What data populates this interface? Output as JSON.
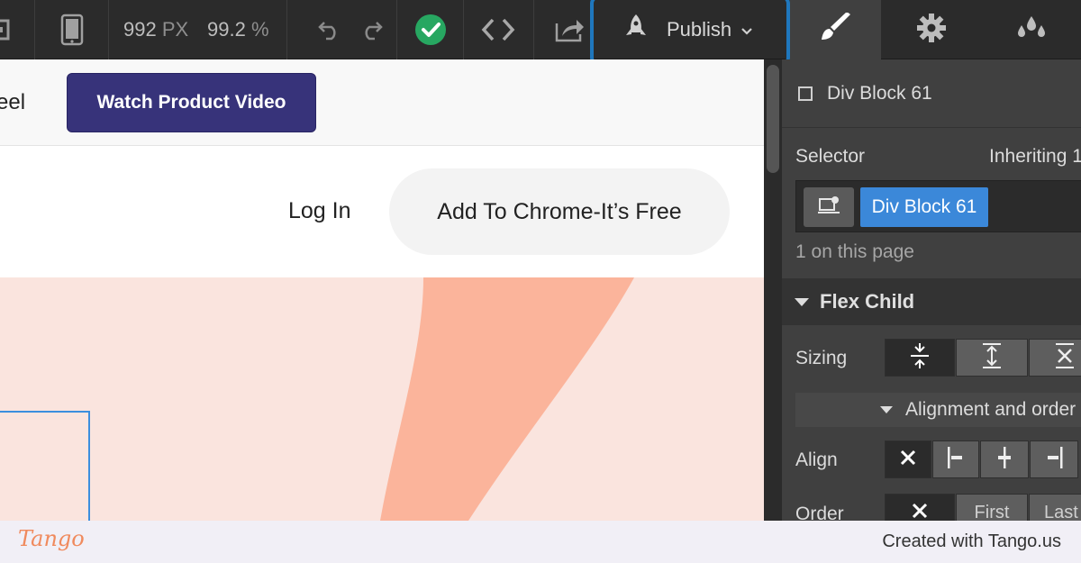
{
  "toolbar": {
    "width_value": "992",
    "width_unit": "PX",
    "zoom_value": "99.2",
    "zoom_unit": "%",
    "publish_label": "Publish"
  },
  "canvas": {
    "banner_left_text": "eel",
    "video_button_label": "Watch Product Video",
    "login_label": "Log In",
    "cta_label": "Add To Chrome-It’s Free"
  },
  "panel": {
    "element_name": "Div Block 61",
    "selector_label": "Selector",
    "inheriting_label": "Inheriting 1",
    "selector_chip": "Div Block 61",
    "count_text": "1 on this page",
    "section_title": "Flex Child",
    "sizing_label": "Sizing",
    "alignment_label": "Alignment and order",
    "align_label": "Align",
    "order_label": "Order",
    "order_first": "First",
    "order_last": "Last"
  },
  "footer": {
    "logo_text": "Tango",
    "credit_text": "Created with Tango.us"
  },
  "colors": {
    "toolbar_bg": "#2b2b2b",
    "publish_highlight": "#1f77bd",
    "video_button": "#37337a",
    "selector_chip": "#3b88d9",
    "hero_bg": "#fae4de",
    "hero_shape": "#fbb49b",
    "tango_brand": "#f08a5d"
  }
}
